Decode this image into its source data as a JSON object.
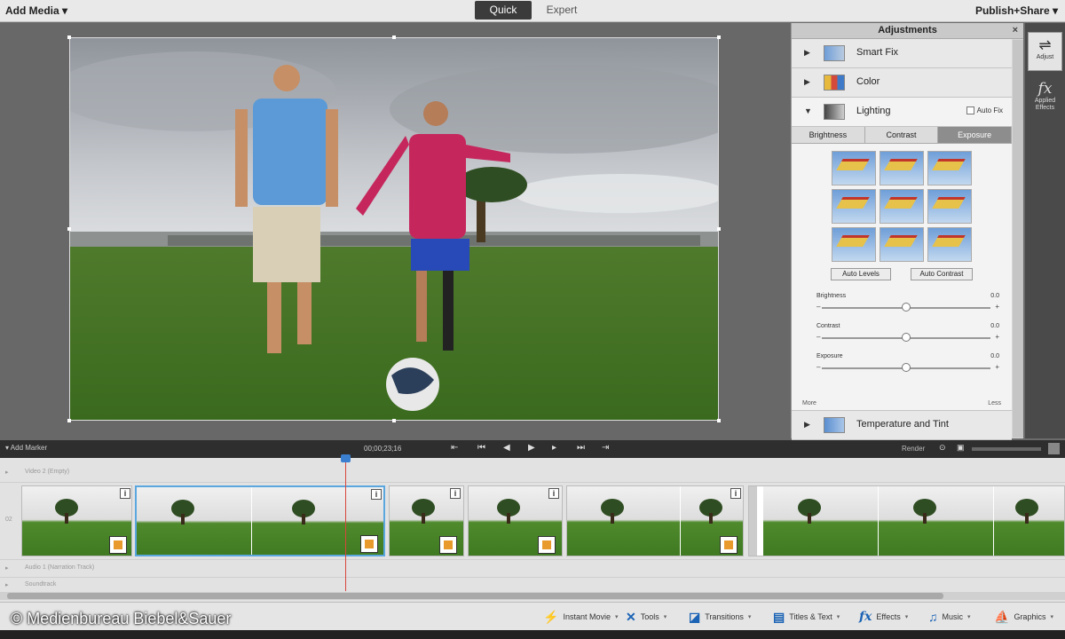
{
  "topbar": {
    "add_media": "Add Media ▾",
    "mode_quick": "Quick",
    "mode_expert": "Expert",
    "publish_share": "Publish+Share ▾"
  },
  "adjustments": {
    "title": "Adjustments",
    "close": "×",
    "sections": {
      "smart_fix": "Smart Fix",
      "color": "Color",
      "lighting": "Lighting",
      "temperature": "Temperature and Tint"
    },
    "auto_fix": "Auto Fix",
    "subtabs": [
      "Brightness",
      "Contrast",
      "Exposure"
    ],
    "active_subtab": "Exposure",
    "auto_levels": "Auto Levels",
    "auto_contrast": "Auto Contrast",
    "sliders": [
      {
        "label": "Brightness",
        "value": "0.0",
        "level": 0.5
      },
      {
        "label": "Contrast",
        "value": "0.0",
        "level": 0.5
      },
      {
        "label": "Exposure",
        "value": "0.0",
        "level": 0.5
      }
    ],
    "more": "More",
    "less": "Less"
  },
  "side_rail": {
    "adjust": "Adjust",
    "applied_effects": "Applied Effects"
  },
  "transport": {
    "add_marker": "Add Marker",
    "timecode": "00;00;23;16",
    "render": "Render"
  },
  "tracks": {
    "video_track_1": "Video 2 (Empty)",
    "audio_track_1": "Audio 1 (Narration Track)",
    "audio_track_2": "Soundtrack",
    "track_num": "02"
  },
  "actions": [
    {
      "icon": "⚡",
      "label": "Instant Movie"
    },
    {
      "icon": "✕",
      "label": "Tools"
    },
    {
      "icon": "◪",
      "label": "Transitions"
    },
    {
      "icon": "▤",
      "label": "Titles & Text"
    },
    {
      "icon": "fx",
      "label": "Effects"
    },
    {
      "icon": "♫",
      "label": "Music"
    },
    {
      "icon": "⛵",
      "label": "Graphics"
    }
  ],
  "watermark": "© Medienbureau Biebel&Sauer"
}
